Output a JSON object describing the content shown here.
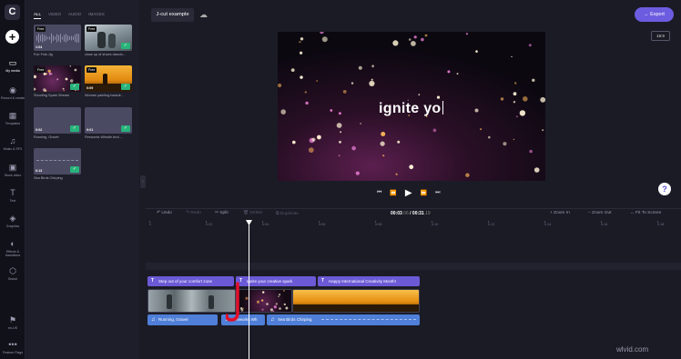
{
  "app": {
    "logo": "C"
  },
  "rail": {
    "items": [
      {
        "icon": "folder-icon",
        "glyph": "▭",
        "label": "My media",
        "active": true
      },
      {
        "icon": "record-icon",
        "glyph": "◉",
        "label": "Record & create"
      },
      {
        "icon": "templates-icon",
        "glyph": "▦",
        "label": "Templates"
      },
      {
        "icon": "music-icon",
        "glyph": "♫",
        "label": "Music & SFX"
      },
      {
        "icon": "stock-video-icon",
        "glyph": "▣",
        "label": "Stock video"
      },
      {
        "icon": "text-icon",
        "glyph": "T",
        "label": "Text"
      },
      {
        "icon": "graphics-icon",
        "glyph": "◈",
        "label": "Graphics"
      },
      {
        "icon": "effects-icon",
        "glyph": "◐",
        "label": "Effects & transitions"
      },
      {
        "icon": "brand-icon",
        "glyph": "⬡",
        "label": "Brand"
      }
    ],
    "bottom": [
      {
        "icon": "flag-icon",
        "glyph": "⚑",
        "label": "en-US"
      },
      {
        "icon": "more-icon",
        "glyph": "•••",
        "label": "Feature Flags"
      }
    ]
  },
  "media": {
    "tabs": [
      "ALL",
      "VIDEO",
      "AUDIO",
      "IMAGES"
    ],
    "active_tab": "ALL",
    "items": [
      {
        "caption": "Fun Folk.Jig",
        "badge": "Free",
        "duration": "1:04",
        "kind": "audio",
        "checked": false
      },
      {
        "caption": "close up of shoes dancin...",
        "badge": "Free",
        "duration": "",
        "kind": "video-dance",
        "checked": true
      },
      {
        "caption": "Shooting Spark Stream",
        "badge": "Free",
        "duration": "",
        "kind": "video-sparks",
        "checked": true
      },
      {
        "caption": "Woman painting backdr...",
        "badge": "Free",
        "duration": "0:09",
        "kind": "video-sunset",
        "checked": true
      },
      {
        "caption": "Running, Gravel",
        "badge": "",
        "duration": "0:02",
        "kind": "audio",
        "checked": true
      },
      {
        "caption": "Fireworks Whistle And ...",
        "badge": "",
        "duration": "0:01",
        "kind": "audio",
        "checked": true
      },
      {
        "caption": "Sea Birds Chirping",
        "badge": "",
        "duration": "0:13",
        "kind": "audio-wave",
        "checked": true
      }
    ]
  },
  "topbar": {
    "project_name": "J-cut example",
    "export_label": "Export",
    "ratio": "16:9"
  },
  "preview": {
    "overlay_text": "ignite yo"
  },
  "timeline": {
    "toolbar": {
      "undo": "Undo",
      "redo": "Redo",
      "split": "Split",
      "delete": "Delete",
      "duplicate": "Duplicate",
      "zoom_in": "Zoom In",
      "zoom_out": "Zoom Out",
      "fit": "Fit To Screen"
    },
    "current_time": "00:03",
    "current_frac": ".06",
    "total_time": "00:31",
    "total_frac": ".19",
    "ruler_labels": [
      "0",
      "0:02",
      "0:04",
      "0:06",
      "0:08",
      "0:10",
      "0:12",
      "0:14",
      "0:16",
      "0:18",
      "0:20"
    ],
    "text_clips": [
      {
        "label": "Step out of your comfort zone"
      },
      {
        "label": "Ignite your creative spark"
      },
      {
        "label": "Happy International Creativity Month!"
      }
    ],
    "audio_clips": [
      {
        "label": "Running, Gravel"
      },
      {
        "label": "Fireworks Wh"
      },
      {
        "label": "Sea Birds Chirping"
      }
    ]
  },
  "watermark": "wlvid.com",
  "colors": {
    "accent": "#6c5ce0",
    "text_clip": "#6a5ad6",
    "audio_clip": "#4f7fd8",
    "check": "#27b37a",
    "annotation": "#e0102a"
  }
}
